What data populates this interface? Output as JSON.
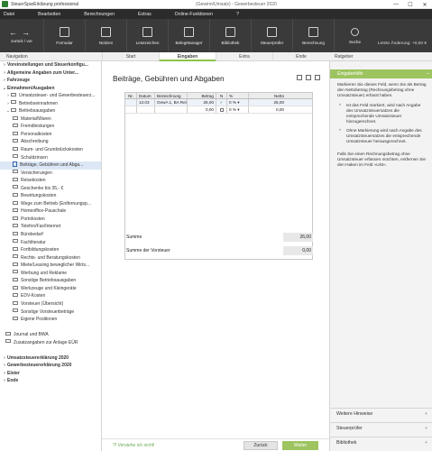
{
  "titlebar": {
    "app": "SteuerSparErklärung professional",
    "doc": "(Gewinn/Umsatz) - Gewerbesteuer 2020",
    "min": "—",
    "max": "☐",
    "close": "✕"
  },
  "menu": [
    "Datei",
    "Bearbeiten",
    "Berechnungen",
    "Extras",
    "Online-Funktionen",
    "?"
  ],
  "toolbar": {
    "nav_label": "zurück / vor",
    "buttons": [
      "Formular",
      "Notizen",
      "Lesezeichen",
      "BelegManager",
      "Bibliothek",
      "Steuerprüfer",
      "Berechnung",
      "Suche"
    ],
    "last_change": "Letzte Änderung: +0,00 €"
  },
  "header": {
    "navigation": "Navigation",
    "tabs": [
      "Start",
      "Eingaben",
      "Extra",
      "Ende"
    ],
    "ratgeber": "Ratgeber"
  },
  "sidebar": [
    {
      "label": "Voreinstellungen und Steuerkonfigu...",
      "bold": true,
      "chev": "›",
      "indent": 0,
      "icon": "none"
    },
    {
      "label": "Allgemeine Angaben zum Unter...",
      "bold": true,
      "chev": "›",
      "indent": 0,
      "icon": "none"
    },
    {
      "label": "Fahrzeuge",
      "bold": true,
      "chev": "›",
      "indent": 0,
      "icon": "none"
    },
    {
      "label": "Einnahmen/Ausgaben",
      "bold": true,
      "chev": "⌄",
      "indent": 0,
      "icon": "none"
    },
    {
      "label": "Umsatzsteuer- und Gewerbesteuerz...",
      "bold": false,
      "chev": "›",
      "indent": 1,
      "icon": "folder"
    },
    {
      "label": "Betriebseinnahmen",
      "bold": false,
      "chev": "›",
      "indent": 1,
      "icon": "folder"
    },
    {
      "label": "Betriebsausgaben",
      "bold": false,
      "chev": "⌄",
      "indent": 1,
      "icon": "folder"
    },
    {
      "label": "Material/Waren",
      "bold": false,
      "chev": "",
      "indent": 2,
      "icon": "folder"
    },
    {
      "label": "Fremdleistungen",
      "bold": false,
      "chev": "",
      "indent": 2,
      "icon": "folder"
    },
    {
      "label": "Personalkosten",
      "bold": false,
      "chev": "",
      "indent": 2,
      "icon": "folder"
    },
    {
      "label": "Abschreibung",
      "bold": false,
      "chev": "",
      "indent": 2,
      "icon": "folder"
    },
    {
      "label": "Raum- und Grundstückskosten",
      "bold": false,
      "chev": "",
      "indent": 2,
      "icon": "folder"
    },
    {
      "label": "Schuldzinsen",
      "bold": false,
      "chev": "",
      "indent": 2,
      "icon": "folder"
    },
    {
      "label": "Beiträge, Gebühren und Abga...",
      "bold": false,
      "chev": "",
      "indent": 2,
      "icon": "doc",
      "selected": true
    },
    {
      "label": "Versicherungen",
      "bold": false,
      "chev": "",
      "indent": 2,
      "icon": "folder"
    },
    {
      "label": "Reisekosten",
      "bold": false,
      "chev": "",
      "indent": 2,
      "icon": "folder"
    },
    {
      "label": "Geschenke bis 35,- €",
      "bold": false,
      "chev": "",
      "indent": 2,
      "icon": "folder"
    },
    {
      "label": "Bewirtungskosten",
      "bold": false,
      "chev": "",
      "indent": 2,
      "icon": "folder"
    },
    {
      "label": "Wege zum Betrieb (Entfernungsp...",
      "bold": false,
      "chev": "",
      "indent": 2,
      "icon": "folder"
    },
    {
      "label": "Homeoffice-Pauschale",
      "bold": false,
      "chev": "",
      "indent": 2,
      "icon": "folder"
    },
    {
      "label": "Portokosten",
      "bold": false,
      "chev": "",
      "indent": 2,
      "icon": "folder"
    },
    {
      "label": "Telefon/Fax/Internet",
      "bold": false,
      "chev": "",
      "indent": 2,
      "icon": "folder"
    },
    {
      "label": "Bürobedarf",
      "bold": false,
      "chev": "",
      "indent": 2,
      "icon": "folder"
    },
    {
      "label": "Fachliteratur",
      "bold": false,
      "chev": "",
      "indent": 2,
      "icon": "folder"
    },
    {
      "label": "Fortbildungskosten",
      "bold": false,
      "chev": "",
      "indent": 2,
      "icon": "folder"
    },
    {
      "label": "Rechts- und Beratungskosten",
      "bold": false,
      "chev": "",
      "indent": 2,
      "icon": "folder"
    },
    {
      "label": "Miete/Leasing beweglicher Wirts...",
      "bold": false,
      "chev": "",
      "indent": 2,
      "icon": "folder"
    },
    {
      "label": "Werbung und Reklame",
      "bold": false,
      "chev": "",
      "indent": 2,
      "icon": "folder"
    },
    {
      "label": "Sonstige Betriebsausgaben",
      "bold": false,
      "chev": "",
      "indent": 2,
      "icon": "folder"
    },
    {
      "label": "Werkzeuge und Kleingeräte",
      "bold": false,
      "chev": "",
      "indent": 2,
      "icon": "folder"
    },
    {
      "label": "EDV-Kosten",
      "bold": false,
      "chev": "",
      "indent": 2,
      "icon": "folder"
    },
    {
      "label": "Vorsteuer (Übersicht)",
      "bold": false,
      "chev": "",
      "indent": 2,
      "icon": "folder"
    },
    {
      "label": "Sonstige Vorsteuerbeträge",
      "bold": false,
      "chev": "",
      "indent": 2,
      "icon": "folder"
    },
    {
      "label": "Eigene Positionen",
      "bold": false,
      "chev": "",
      "indent": 2,
      "icon": "folder"
    },
    {
      "label": "",
      "bold": false,
      "chev": "",
      "indent": 0,
      "icon": "none"
    },
    {
      "label": "Journal und BWA",
      "bold": false,
      "chev": "",
      "indent": 1,
      "icon": "folder"
    },
    {
      "label": "Zusatzangaben zur Anlage EÜR",
      "bold": false,
      "chev": "",
      "indent": 1,
      "icon": "folder"
    },
    {
      "label": "",
      "bold": false,
      "chev": "",
      "indent": 0,
      "icon": "none"
    },
    {
      "label": "Umsatzsteuererklärung 2020",
      "bold": true,
      "chev": "›",
      "indent": 0,
      "icon": "none"
    },
    {
      "label": "Gewerbesteuererklärung 2020",
      "bold": true,
      "chev": "›",
      "indent": 0,
      "icon": "none"
    },
    {
      "label": "Elster",
      "bold": true,
      "chev": "›",
      "indent": 0,
      "icon": "none"
    },
    {
      "label": "Ende",
      "bold": true,
      "chev": "›",
      "indent": 0,
      "icon": "none"
    }
  ],
  "main": {
    "title": "Beiträge, Gebühren und Abgaben",
    "columns": [
      "Nr.",
      "Datum",
      "Bezeichnung",
      "Betrag",
      "N",
      "%",
      "Netto"
    ],
    "rows": [
      {
        "nr": "",
        "datum": "13.03",
        "bez": "GewA 1, BA Reinic",
        "betrag": "26,00",
        "n": "✓",
        "pct": "0 %",
        "netto": "26,00"
      },
      {
        "nr": "",
        "datum": "",
        "bez": "",
        "betrag": "0,00",
        "n": "",
        "pct": "0 %",
        "netto": "0,00"
      }
    ],
    "summe_label": "Summe",
    "summe_value": "26,00",
    "vorsteuer_label": "Summe der Vorsteuer",
    "vorsteuer_value": "0,00",
    "verstehe": "?! Verstehe ich nicht!",
    "btn_back": "Zurück",
    "btn_next": "Weiter"
  },
  "ratgeber": {
    "eingabehilfe": "Eingabehilfe",
    "intro": "Markieren Sie dieses Feld, wenn Sie als Betrag den Nettobetrag (Rechnungsbetrag ohne Umsatzsteuer) erfasst haben.",
    "bullet1": "Ist das Feld markiert, wird nach Angabe des Umsatzsteuersatzes die entsprechende Umsatzsteuer hinzugerechnet.",
    "bullet2": "Ohne Markierung wird nach Angabe des Umsatzsteuersatzes die entsprechende Umsatzsteuer herausgerechnet.",
    "outro": "Falls Sie einen Rechnungsbetrag ohne Umsatzsteuer erfassen möchten, entfernen Sie den Haken im Feld »USt«.",
    "sections": [
      "Weitere Hinweise",
      "Steuerprüfer",
      "Bibliothek"
    ]
  },
  "colors": {
    "accent": "#9dc45f",
    "toolbar": "#3a3a3a",
    "menubar": "#2b2b2b",
    "selection": "#dbe7f5"
  }
}
